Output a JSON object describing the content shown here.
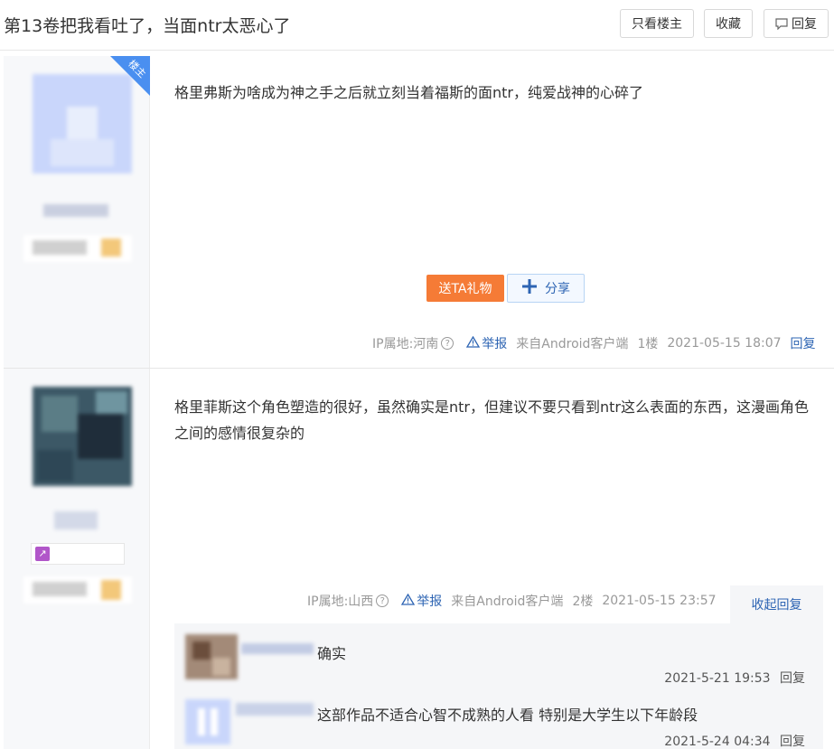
{
  "header": {
    "title": "第13卷把我看吐了，当面ntr太恶心了",
    "only_op_label": "只看楼主",
    "favorite_label": "收藏",
    "reply_label": "回复"
  },
  "posts": [
    {
      "badge": "楼主",
      "content": "格里弗斯为啥成为神之手之后就立刻当着福斯的面ntr，纯爱战神的心碎了",
      "gift_label": "送TA礼物",
      "share_label": "分享",
      "ip": "IP属地:河南",
      "report": "举报",
      "client": "来自Android客户端",
      "floor": "1楼",
      "time": "2021-05-15 18:07",
      "reply": "回复"
    },
    {
      "content": "格里菲斯这个角色塑造的很好，虽然确实是ntr，但建议不要只看到ntr这么表面的东西，这漫画角色之间的感情很复杂的",
      "ip": "IP属地:山西",
      "report": "举报",
      "client": "来自Android客户端",
      "floor": "2楼",
      "time": "2021-05-15 23:57",
      "collapse": "收起回复",
      "sub_replies": [
        {
          "text": "确实",
          "time": "2021-5-21 19:53",
          "reply": "回复"
        },
        {
          "text": "这部作品不适合心智不成熟的人看 特别是大学生以下年龄段",
          "time": "2021-5-24 04:34",
          "reply": "回复"
        }
      ]
    }
  ],
  "colors": {
    "accent": "#2d64b3",
    "gift": "#f57b36",
    "op_badge": "#4a8ff0"
  }
}
